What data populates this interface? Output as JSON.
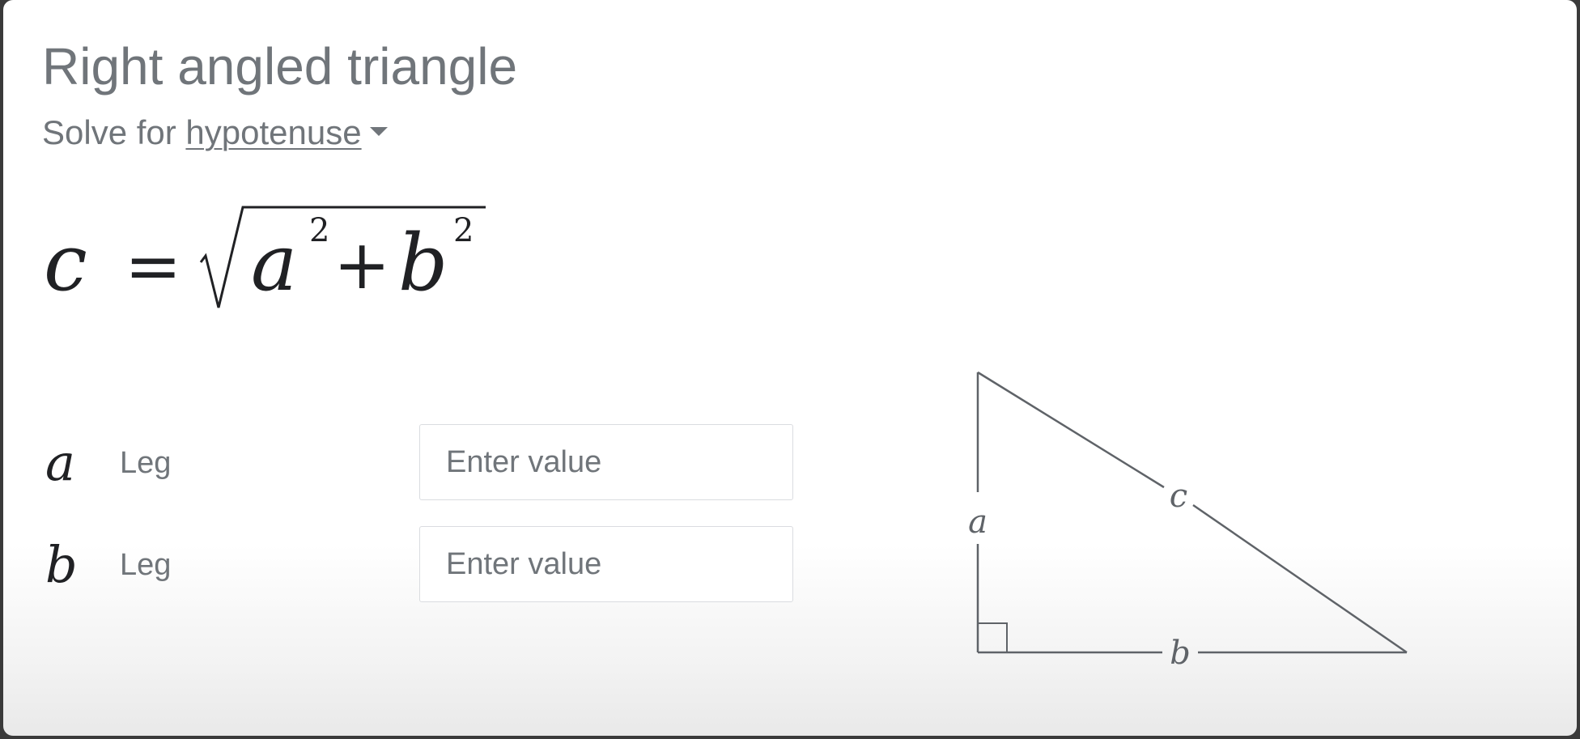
{
  "calculator": {
    "title": "Right angled triangle",
    "solve_prefix": "Solve for",
    "solve_target": "hypotenuse",
    "formula": {
      "lhs": "c",
      "equals": "=",
      "term1": "a",
      "exp1": "2",
      "plus": "+",
      "term2": "b",
      "exp2": "2"
    },
    "variables": [
      {
        "symbol": "a",
        "label": "Leg",
        "value": "",
        "placeholder": "Enter value"
      },
      {
        "symbol": "b",
        "label": "Leg",
        "value": "",
        "placeholder": "Enter value"
      }
    ],
    "diagram": {
      "side_a": "a",
      "side_b": "b",
      "side_c": "c"
    }
  },
  "icons": {
    "dropdown": "caret-down-icon",
    "right_angle": "right-angle-marker-icon"
  },
  "colors": {
    "title_text": "#70757a",
    "formula_text": "#202124",
    "input_border": "#dadce0",
    "diagram_stroke": "#5f6368"
  }
}
